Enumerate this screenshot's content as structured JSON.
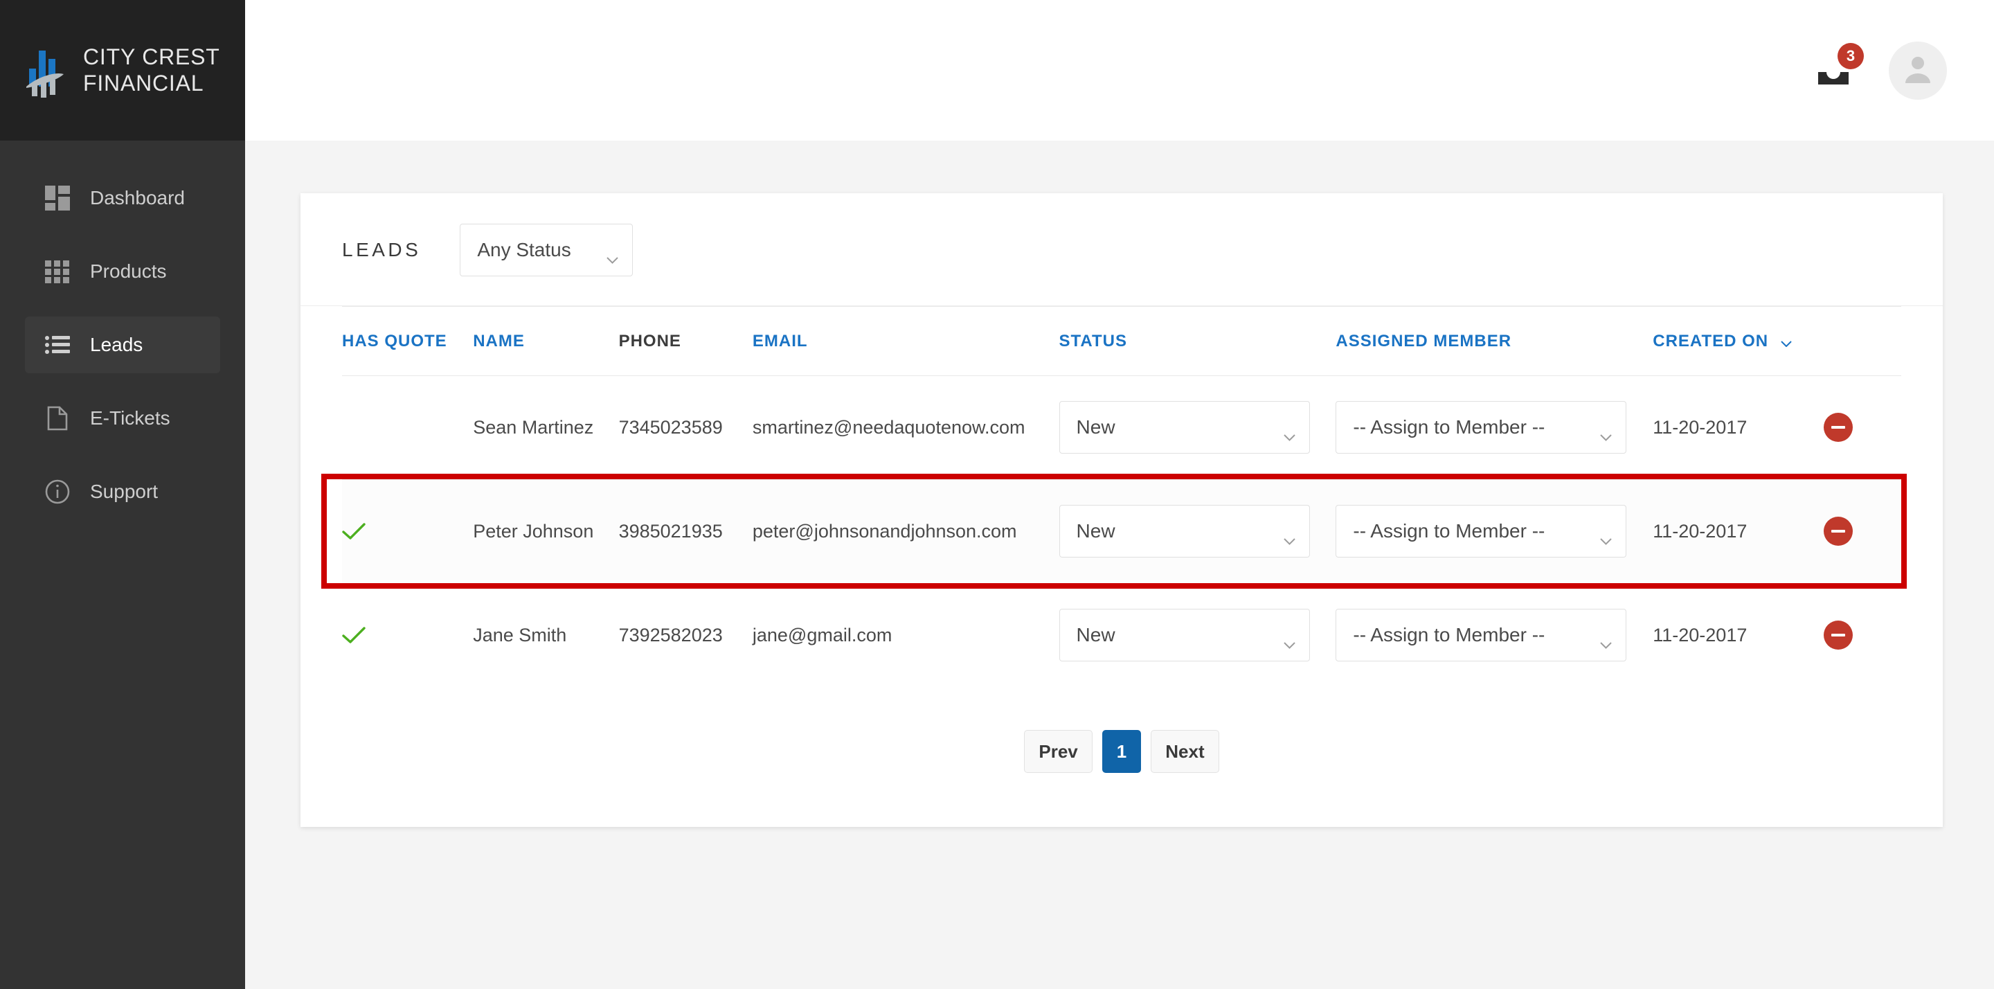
{
  "brand": {
    "name_line1": "CITY CREST",
    "name_line2": "FINANCIAL",
    "logo_icon": "bar-chart-swoosh-logo",
    "accent_blue": "#1a73c4",
    "logo_blue": "#1b76c4",
    "logo_gray": "#b6bcc0"
  },
  "sidebar": {
    "items": [
      {
        "label": "Dashboard",
        "icon": "dashboard-grid-icon",
        "active": false
      },
      {
        "label": "Products",
        "icon": "apps-grid-icon",
        "active": false
      },
      {
        "label": "Leads",
        "icon": "list-bullet-icon",
        "active": true
      },
      {
        "label": "E-Tickets",
        "icon": "document-page-icon",
        "active": false
      },
      {
        "label": "Support",
        "icon": "info-circle-icon",
        "active": false
      }
    ]
  },
  "topbar": {
    "notifications_icon": "inbox-tray-icon",
    "notifications_count": "3",
    "badge_color": "#c0392b",
    "avatar_icon": "user-avatar-icon"
  },
  "card": {
    "title": "LEADS",
    "status_filter": {
      "selected": "Any Status",
      "icon": "chevron-down-icon"
    },
    "columns": [
      {
        "label": "HAS QUOTE",
        "link": true
      },
      {
        "label": "NAME",
        "link": true
      },
      {
        "label": "PHONE",
        "link": false
      },
      {
        "label": "EMAIL",
        "link": true
      },
      {
        "label": "STATUS",
        "link": true
      },
      {
        "label": "ASSIGNED MEMBER",
        "link": true
      },
      {
        "label": "CREATED ON",
        "link": true,
        "sort_icon": "chevron-down-icon"
      }
    ],
    "rows": [
      {
        "has_quote": false,
        "has_quote_icon": "",
        "name": "Sean Martinez",
        "phone": "7345023589",
        "email": "smartinez@needaquotenow.com",
        "status": "New",
        "assigned_member": "-- Assign to Member --",
        "created_on": "11-20-2017",
        "delete_icon": "remove-circle-icon",
        "highlighted": false
      },
      {
        "has_quote": true,
        "has_quote_icon": "check-icon",
        "name": "Peter Johnson",
        "phone": "3985021935",
        "email": "peter@johnsonandjohnson.com",
        "status": "New",
        "assigned_member": "-- Assign to Member --",
        "created_on": "11-20-2017",
        "delete_icon": "remove-circle-icon",
        "highlighted": true
      },
      {
        "has_quote": true,
        "has_quote_icon": "check-icon",
        "name": "Jane Smith",
        "phone": "7392582023",
        "email": "jane@gmail.com",
        "status": "New",
        "assigned_member": "-- Assign to Member --",
        "created_on": "11-20-2017",
        "delete_icon": "remove-circle-icon",
        "highlighted": false
      }
    ],
    "pagination": {
      "prev_label": "Prev",
      "next_label": "Next",
      "pages": [
        "1"
      ],
      "current_page": "1"
    }
  },
  "annotation": {
    "color": "#cc0000",
    "target_row_index": 1
  }
}
